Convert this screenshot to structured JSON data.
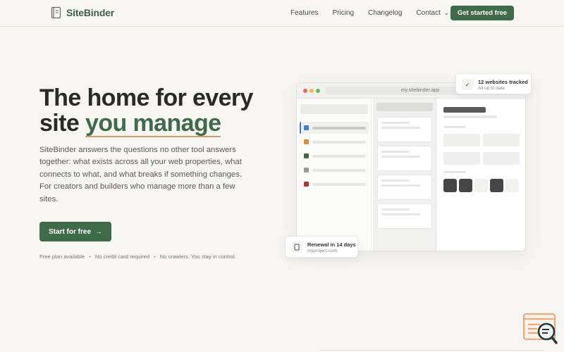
{
  "brand": {
    "name": "SiteBinder",
    "color": "#3f6b4a"
  },
  "nav": {
    "links": [
      "Features",
      "Pricing",
      "Changelog"
    ],
    "contact": "Contact",
    "cta": "Get started free"
  },
  "hero": {
    "title_line1": "The home for every",
    "title_line2_plain": "site ",
    "title_line2_accent": "you manage",
    "description": "SiteBinder answers the questions no other tool answers together: what exists across all your web properties, what connects to what, and what breaks if something changes. For creators and builders who manage more than a few sites.",
    "cta": "Start for free",
    "fineprint": [
      "Free plan available",
      "No credit card required",
      "No crawlers. You stay in control."
    ]
  },
  "mock": {
    "url": "my.sitebinder.app",
    "sidebar_colors": [
      "#3b7ddd",
      "#e08a3c",
      "#3f6b4a",
      "#9a9a9a",
      "#b8352f"
    ]
  },
  "badges": {
    "top": {
      "icon": "check-icon",
      "title": "12 websites tracked",
      "sub": "All up to date"
    },
    "bottom": {
      "icon": "document-icon",
      "title": "Renewal in 14 days",
      "sub": "myproject.com"
    }
  }
}
